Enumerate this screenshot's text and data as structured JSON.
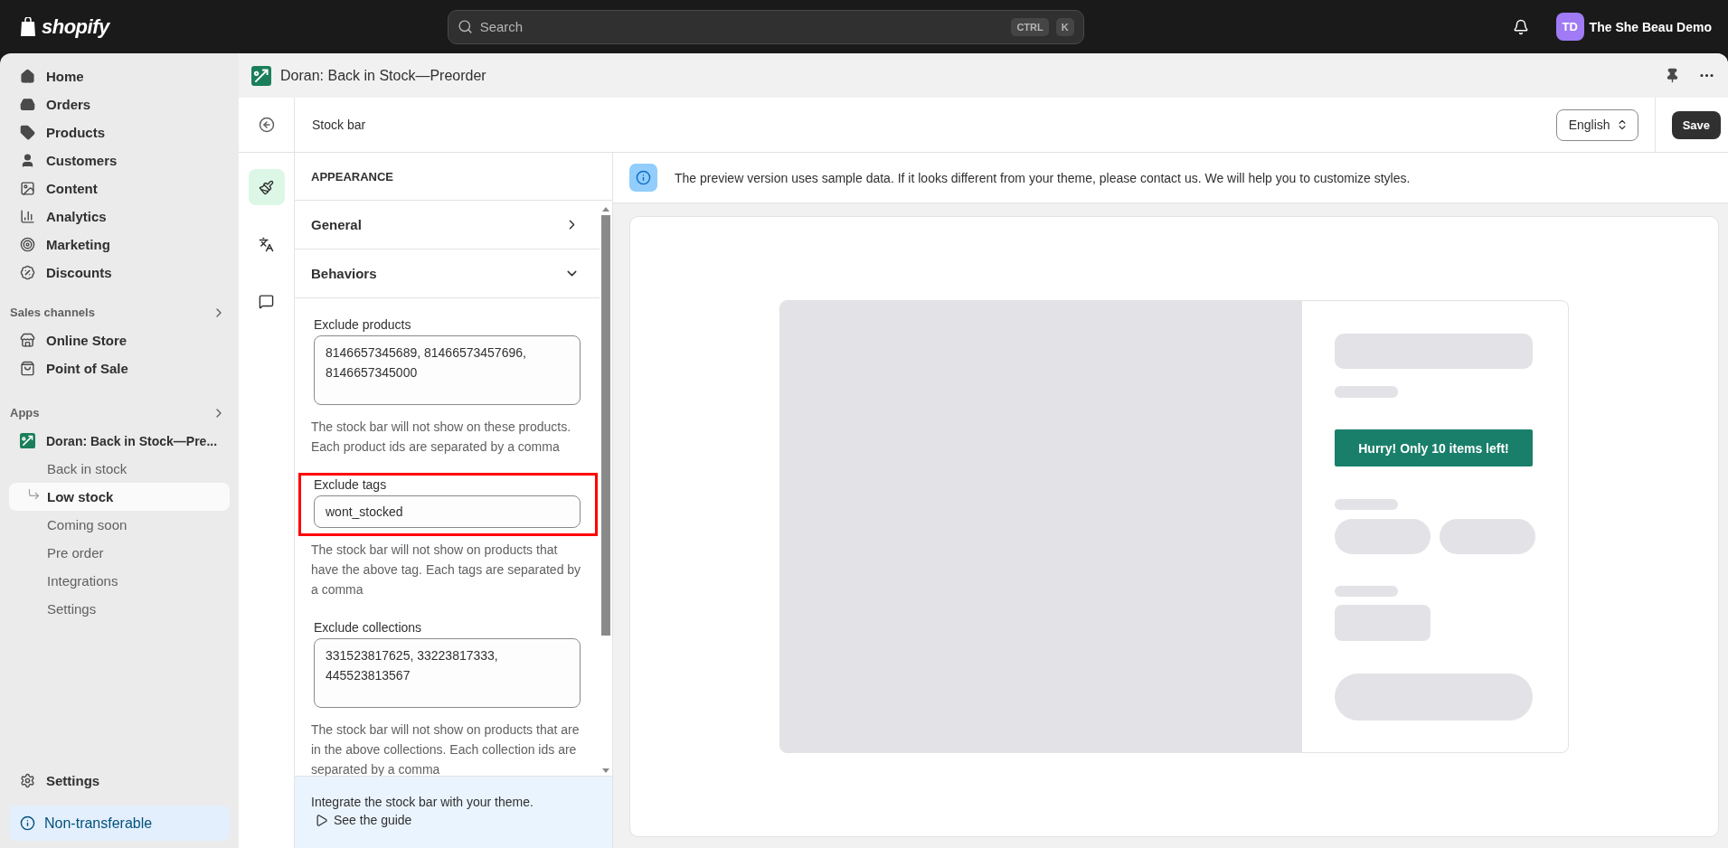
{
  "topbar": {
    "logo": "shopify",
    "search": {
      "placeholder": "Search",
      "keys": [
        "CTRL",
        "K"
      ]
    },
    "store": {
      "initials": "TD",
      "name": "The She Beau Demo"
    }
  },
  "sidebar": {
    "nav": [
      {
        "label": "Home",
        "selected": false
      },
      {
        "label": "Orders",
        "selected": false
      },
      {
        "label": "Products",
        "selected": false
      },
      {
        "label": "Customers",
        "selected": false
      },
      {
        "label": "Content",
        "selected": false
      },
      {
        "label": "Analytics",
        "selected": false
      },
      {
        "label": "Marketing",
        "selected": false
      },
      {
        "label": "Discounts",
        "selected": false
      }
    ],
    "sales_channels": {
      "title": "Sales channels",
      "items": [
        {
          "label": "Online Store"
        },
        {
          "label": "Point of Sale"
        }
      ]
    },
    "apps": {
      "title": "Apps",
      "app": "Doran: Back in Stock—Pre...",
      "children": [
        {
          "label": "Back in stock",
          "selected": false
        },
        {
          "label": "Low stock",
          "selected": true
        },
        {
          "label": "Coming soon",
          "selected": false
        },
        {
          "label": "Pre order",
          "selected": false
        },
        {
          "label": "Integrations",
          "selected": false
        },
        {
          "label": "Settings",
          "selected": false
        }
      ]
    },
    "settings": "Settings",
    "notice": "Non-transferable"
  },
  "app_header": {
    "title": "Doran: Back in Stock—Preorder"
  },
  "toolbar": {
    "title": "Stock bar",
    "language": "English",
    "save": "Save"
  },
  "rail": [
    {
      "kind": "brush",
      "selected": true
    },
    {
      "kind": "translate",
      "selected": false
    },
    {
      "kind": "chat",
      "selected": false
    }
  ],
  "panel": {
    "heading": "APPEARANCE",
    "sections": [
      {
        "label": "General",
        "expanded": false
      },
      {
        "label": "Behaviors",
        "expanded": true
      }
    ],
    "fields": [
      {
        "kind": "textarea",
        "label": "Exclude products",
        "value": "8146657345689, 81466573457696, 8146657345000",
        "help": "The stock bar will not show on these products. Each product ids are separated by a comma",
        "highlighted": false
      },
      {
        "kind": "input",
        "label": "Exclude tags",
        "value": "wont_stocked",
        "help": "The stock bar will not show on products that have the above tag. Each tags are separated by a comma",
        "highlighted": true
      },
      {
        "kind": "textarea",
        "label": "Exclude collections",
        "value": "331523817625, 33223817333, 445523813567",
        "help": "The stock bar will not show on products that are in the above collections. Each collection ids are separated by a comma",
        "highlighted": false
      }
    ],
    "footer": {
      "text": "Integrate the stock bar with your theme.",
      "link": "See the guide"
    }
  },
  "preview": {
    "banner": "The preview version uses sample data. If it looks different from your theme, please contact us. We will help you to customize styles.",
    "button": "Hurry! Only 10 items left!"
  }
}
